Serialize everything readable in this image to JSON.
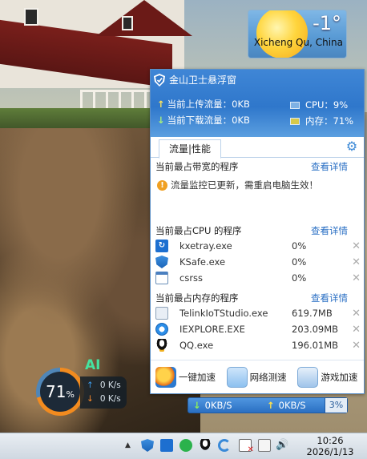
{
  "weather": {
    "temperature": "-1°",
    "city": "Xicheng Qu, China"
  },
  "float_window": {
    "title": "金山卫士悬浮窗",
    "upload_label": "当前上传流量：0KB",
    "download_label": "当前下载流量：0KB",
    "cpu_label": "CPU：9%",
    "memory_label": "内存：71%",
    "tab_label": "流量|性能",
    "settings_icon": "gear-icon",
    "bandwidth_section": {
      "title": "当前最占带宽的程序",
      "details_link": "查看详情",
      "notice": "流量监控已更新，需重启电脑生效！"
    },
    "cpu_section": {
      "title": "当前最占CPU 的程序",
      "details_link": "查看详情",
      "processes": [
        {
          "name": "kxetray.exe",
          "value": "0%",
          "icon": "kxetray-icon"
        },
        {
          "name": "KSafe.exe",
          "value": "0%",
          "icon": "ksafe-shield-icon"
        },
        {
          "name": "csrss",
          "value": "0%",
          "icon": "window-icon"
        }
      ]
    },
    "memory_section": {
      "title": "当前最占内存的程序",
      "details_link": "查看详情",
      "processes": [
        {
          "name": "TelinkIoTStudio.exe",
          "value": "619.7MB",
          "icon": "telink-icon"
        },
        {
          "name": "IEXPLORE.EXE",
          "value": "203.09MB",
          "icon": "ie-icon"
        },
        {
          "name": "QQ.exe",
          "value": "196.01MB",
          "icon": "qq-penguin-icon"
        }
      ]
    },
    "actions": [
      {
        "label": "一键加速",
        "icon": "speedup-icon"
      },
      {
        "label": "网络测速",
        "icon": "speedtest-icon"
      },
      {
        "label": "游戏加速",
        "icon": "gamepad-icon"
      }
    ]
  },
  "speed_bar": {
    "download": "0KB/S",
    "upload": "0KB/S",
    "cpu": "3%"
  },
  "ai_widget": {
    "logo": "AI",
    "percent": "71",
    "percent_unit": "%",
    "usage_fraction": 0.71,
    "upload_speed": "0 K/s",
    "download_speed": "0 K/s"
  },
  "taskbar": {
    "show_hidden_icon": "▲",
    "tray_icons": [
      "ksafe-shield-icon",
      "kxetray-icon",
      "wechat-icon",
      "qq-penguin-icon",
      "refresh-icon",
      "action-center-flag-icon",
      "network-icon",
      "volume-icon"
    ],
    "time": "10:26",
    "date": "2026/1/13"
  },
  "colors": {
    "accent_blue": "#2f77cb",
    "link_blue": "#2a6fc4",
    "ring_orange": "#f28b1f",
    "ai_green": "#45e3a0"
  }
}
